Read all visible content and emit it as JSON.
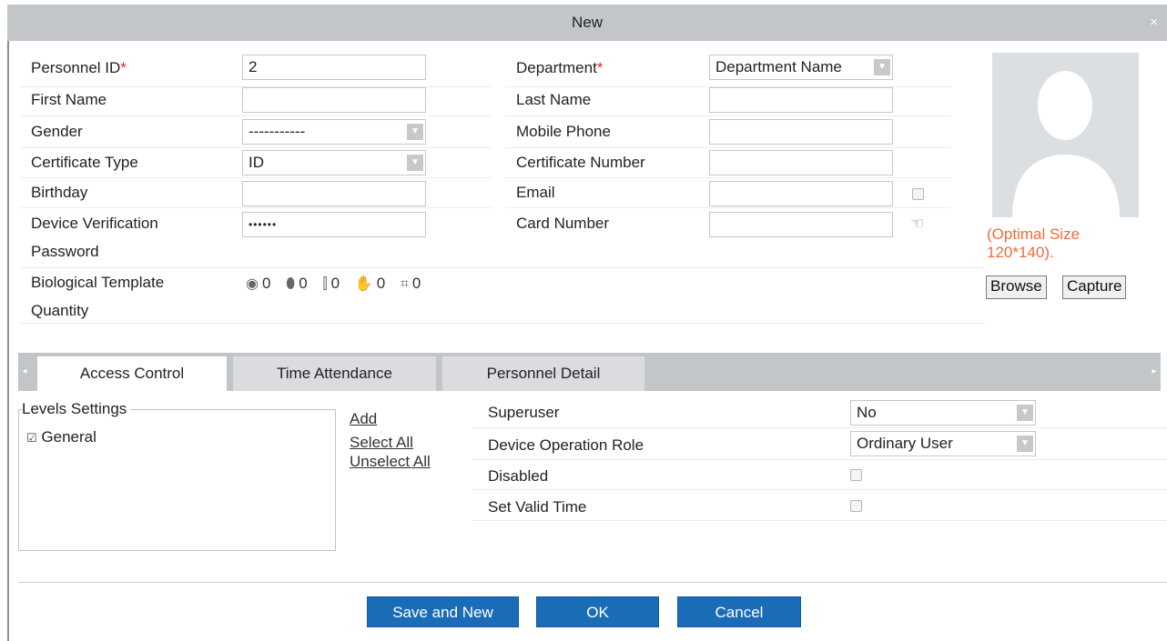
{
  "dialog": {
    "title": "New",
    "close_glyph": "×"
  },
  "form": {
    "personnel_id": {
      "label": "Personnel ID",
      "required_mark": "*",
      "value": "2"
    },
    "first_name": {
      "label": "First Name",
      "value": ""
    },
    "gender": {
      "label": "Gender",
      "value": "-----------"
    },
    "certificate_type": {
      "label": "Certificate Type",
      "value": "ID"
    },
    "birthday": {
      "label": "Birthday",
      "value": ""
    },
    "device_verification_password": {
      "label_line1": "Device Verification",
      "label_line2": "Password",
      "value": "••••••"
    },
    "biological_template": {
      "label_line1": "Biological Template",
      "label_line2": "Quantity",
      "counts": [
        {
          "icon": "fingerprint-icon",
          "value": "0"
        },
        {
          "icon": "finger-vein-icon",
          "value": "0"
        },
        {
          "icon": "palm-vertical-icon",
          "value": "0"
        },
        {
          "icon": "palm-icon",
          "value": "0"
        },
        {
          "icon": "face-icon",
          "value": "0"
        }
      ]
    },
    "department": {
      "label": "Department",
      "required_mark": "*",
      "value": "Department Name"
    },
    "last_name": {
      "label": "Last Name",
      "value": ""
    },
    "mobile_phone": {
      "label": "Mobile Phone",
      "value": ""
    },
    "certificate_number": {
      "label": "Certificate Number",
      "value": ""
    },
    "email": {
      "label": "Email",
      "value": ""
    },
    "card_number": {
      "label": "Card Number",
      "value": ""
    }
  },
  "photo": {
    "note": "(Optimal Size 120*140).",
    "browse_label": "Browse",
    "capture_label": "Capture"
  },
  "tabs": [
    {
      "label": "Access Control",
      "active": true
    },
    {
      "label": "Time Attendance",
      "active": false
    },
    {
      "label": "Personnel Detail",
      "active": false
    }
  ],
  "access_control": {
    "levels_title": "Levels Settings",
    "levels": [
      {
        "label": "General",
        "checked": true
      }
    ],
    "add_label": "Add",
    "select_all_label": "Select All",
    "unselect_all_label": "Unselect All",
    "superuser": {
      "label": "Superuser",
      "value": "No"
    },
    "device_operation_role": {
      "label": "Device Operation Role",
      "value": "Ordinary User"
    },
    "disabled": {
      "label": "Disabled",
      "checked": false
    },
    "set_valid_time": {
      "label": "Set Valid Time",
      "checked": false
    }
  },
  "footer": {
    "save_new_label": "Save and New",
    "ok_label": "OK",
    "cancel_label": "Cancel"
  },
  "colors": {
    "accent": "#1a6cb6",
    "title_bar": "#c3c6c9",
    "required": "#e3262a",
    "note": "#f26b3a"
  }
}
